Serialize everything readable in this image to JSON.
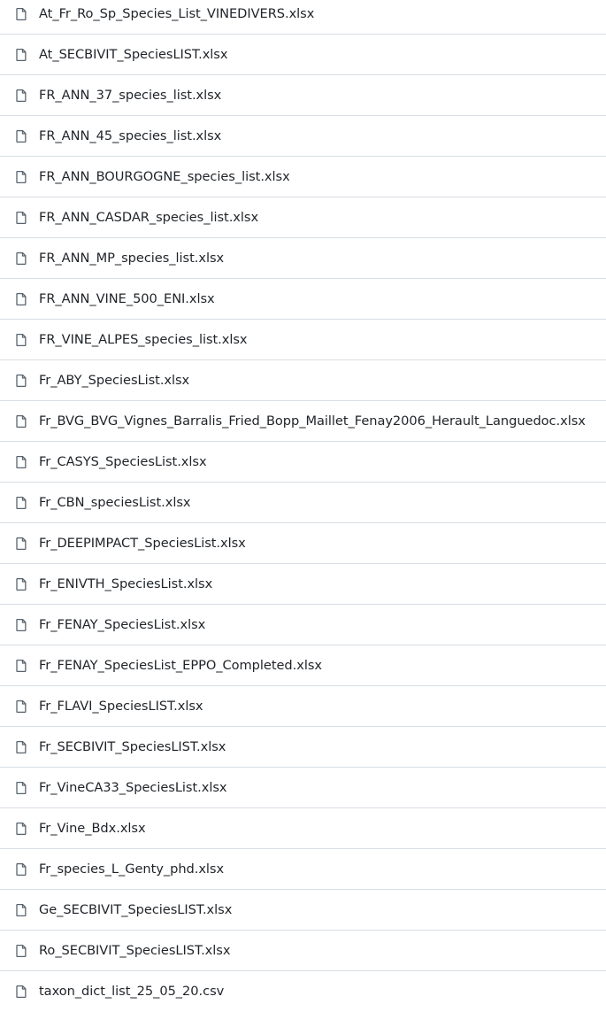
{
  "files": [
    {
      "name": "At_Fr_Ro_Sp_Species_List_VINEDIVERS.xlsx",
      "icon": "file-icon"
    },
    {
      "name": "At_SECBIVIT_SpeciesLIST.xlsx",
      "icon": "file-icon"
    },
    {
      "name": "FR_ANN_37_species_list.xlsx",
      "icon": "file-icon"
    },
    {
      "name": "FR_ANN_45_species_list.xlsx",
      "icon": "file-icon"
    },
    {
      "name": "FR_ANN_BOURGOGNE_species_list.xlsx",
      "icon": "file-icon"
    },
    {
      "name": "FR_ANN_CASDAR_species_list.xlsx",
      "icon": "file-icon"
    },
    {
      "name": "FR_ANN_MP_species_list.xlsx",
      "icon": "file-icon"
    },
    {
      "name": "FR_ANN_VINE_500_ENI.xlsx",
      "icon": "file-icon"
    },
    {
      "name": "FR_VINE_ALPES_species_list.xlsx",
      "icon": "file-icon"
    },
    {
      "name": "Fr_ABY_SpeciesList.xlsx",
      "icon": "file-icon"
    },
    {
      "name": "Fr_BVG_BVG_Vignes_Barralis_Fried_Bopp_Maillet_Fenay2006_Herault_Languedoc.xlsx",
      "icon": "file-icon"
    },
    {
      "name": "Fr_CASYS_SpeciesList.xlsx",
      "icon": "file-icon"
    },
    {
      "name": "Fr_CBN_speciesList.xlsx",
      "icon": "file-icon"
    },
    {
      "name": "Fr_DEEPIMPACT_SpeciesList.xlsx",
      "icon": "file-icon"
    },
    {
      "name": "Fr_ENIVTH_SpeciesList.xlsx",
      "icon": "file-icon"
    },
    {
      "name": "Fr_FENAY_SpeciesList.xlsx",
      "icon": "file-icon"
    },
    {
      "name": "Fr_FENAY_SpeciesList_EPPO_Completed.xlsx",
      "icon": "file-icon"
    },
    {
      "name": "Fr_FLAVI_SpeciesLIST.xlsx",
      "icon": "file-icon"
    },
    {
      "name": "Fr_SECBIVIT_SpeciesLIST.xlsx",
      "icon": "file-icon"
    },
    {
      "name": "Fr_VineCA33_SpeciesList.xlsx",
      "icon": "file-icon"
    },
    {
      "name": "Fr_Vine_Bdx.xlsx",
      "icon": "file-icon"
    },
    {
      "name": "Fr_species_L_Genty_phd.xlsx",
      "icon": "file-icon"
    },
    {
      "name": "Ge_SECBIVIT_SpeciesLIST.xlsx",
      "icon": "file-icon"
    },
    {
      "name": "Ro_SECBIVIT_SpeciesLIST.xlsx",
      "icon": "file-icon"
    },
    {
      "name": "taxon_dict_list_25_05_20.csv",
      "icon": "file-icon"
    }
  ],
  "colors": {
    "text": "#1f2328",
    "icon": "#59636e",
    "divider": "#d8dee4",
    "background": "#ffffff"
  }
}
